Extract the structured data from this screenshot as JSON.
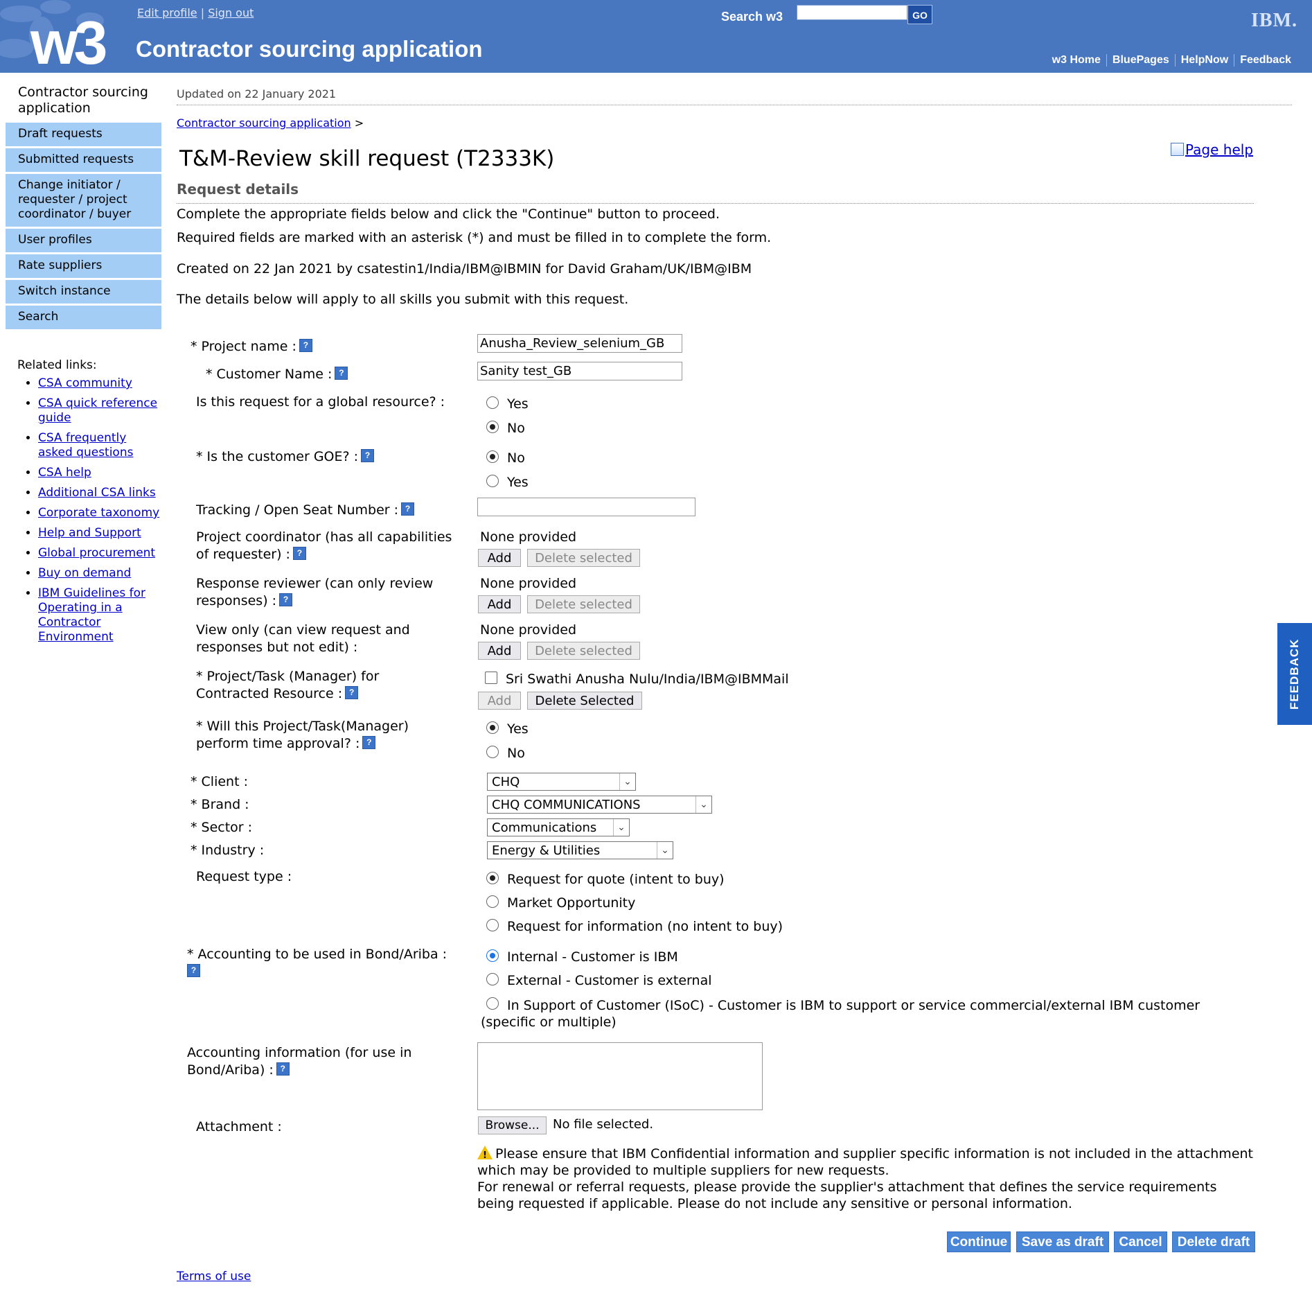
{
  "masthead": {
    "logo": "w3",
    "app_title": "Contractor sourcing application",
    "edit_profile": "Edit profile",
    "sign_out": "Sign out",
    "search_label": "Search w3",
    "search_value": "",
    "go_label": "GO",
    "ibm_logo": "IBM.",
    "nav": [
      "w3 Home",
      "BluePages",
      "HelpNow",
      "Feedback"
    ]
  },
  "leftnav": {
    "title": "Contractor sourcing application",
    "items": [
      "Draft requests",
      "Submitted requests",
      "Change initiator / requester / project coordinator / buyer",
      "User profiles",
      "Rate suppliers",
      "Switch instance",
      "Search"
    ],
    "related_title": "Related links:",
    "related": [
      "CSA community",
      "CSA quick reference guide",
      "CSA frequently asked questions",
      "CSA help",
      "Additional CSA links",
      "Corporate taxonomy",
      "Help and Support",
      "Global procurement",
      "Buy on demand",
      "IBM Guidelines for Operating in a Contractor Environment"
    ]
  },
  "main": {
    "updated": "Updated on 22 January 2021",
    "breadcrumb": "Contractor sourcing application",
    "breadcrumb_sep": ">",
    "title": "T&M-Review skill request (T2333K)",
    "page_help": "Page help",
    "subtitle": "Request details",
    "intro": [
      "Complete the appropriate fields below and click the \"Continue\" button to proceed.",
      "Required fields are marked with an asterisk (*) and must be filled in to complete the form.",
      "Created on 22 Jan 2021 by csatestin1/India/IBM@IBMIN for David Graham/UK/IBM@IBM",
      "The details below will apply to all skills you submit with this request."
    ]
  },
  "form": {
    "project_name_label": "* Project name :",
    "project_name_value": "Anusha_Review_selenium_GB",
    "customer_name_label": "* Customer Name :",
    "customer_name_value": "Sanity test_GB",
    "global_label": "Is this request for a global resource? :",
    "global_options": [
      "Yes",
      "No"
    ],
    "global_selected": "No",
    "goe_label": "* Is the customer GOE? :",
    "goe_options": [
      "No",
      "Yes"
    ],
    "goe_selected": "No",
    "tracking_label": "Tracking / Open Seat Number :",
    "tracking_value": "",
    "coordinator_label": "Project coordinator (has all capabilities of requester) :",
    "coordinator_value": "None provided",
    "reviewer_label": "Response reviewer (can only review responses) :",
    "reviewer_value": "None provided",
    "viewonly_label": "View only (can view request and responses but not edit) :",
    "viewonly_value": "None provided",
    "add_label": "Add",
    "delete_selected_label": "Delete selected",
    "manager_label": "* Project/Task (Manager) for Contracted Resource :",
    "manager_value": "Sri Swathi Anusha Nulu/India/IBM@IBMMail",
    "delete_selected_cap_label": "Delete Selected",
    "time_approval_label": "* Will this Project/Task(Manager) perform time approval? :",
    "time_approval_options": [
      "Yes",
      "No"
    ],
    "time_approval_selected": "Yes",
    "client_label": "* Client :",
    "client_value": "CHQ",
    "brand_label": "* Brand :",
    "brand_value": "CHQ COMMUNICATIONS",
    "sector_label": "* Sector :",
    "sector_value": "Communications",
    "industry_label": "* Industry :",
    "industry_value": "Energy & Utilities",
    "request_type_label": "Request type :",
    "request_type_options": [
      "Request for quote (intent to buy)",
      "Market Opportunity",
      "Request for information (no intent to buy)"
    ],
    "request_type_selected": "Request for quote (intent to buy)",
    "accounting_label": "* Accounting to be used in Bond/Ariba :",
    "accounting_options": [
      "Internal - Customer is IBM",
      "External - Customer is external",
      "In Support of Customer (ISoC) - Customer is IBM to support or service commercial/external IBM customer (specific or multiple)"
    ],
    "accounting_selected": "Internal - Customer is IBM",
    "accounting_info_label": "Accounting information (for use in Bond/Ariba) :",
    "accounting_info_value": "",
    "attachment_label": "Attachment :",
    "browse_label": "Browse...",
    "no_file": "No file selected.",
    "warning_1": "Please ensure that IBM Confidential information and supplier specific information is not included in the attachment which may be provided to multiple suppliers for new requests.",
    "warning_2": "For renewal or referral requests, please provide the supplier's attachment that defines the service requirements being requested if applicable. Please do not include any sensitive or personal information.",
    "help_glyph": "?"
  },
  "actions": [
    "Continue",
    "Save as draft",
    "Cancel",
    "Delete draft"
  ],
  "footer": {
    "terms": "Terms of use"
  },
  "feedback_tab": "FEEDBACK",
  "colors": {
    "masthead": "#4877c0",
    "nav_item": "#a3cdf5",
    "action_button": "#4a86d8",
    "feedback_tab": "#1f5fbf"
  }
}
